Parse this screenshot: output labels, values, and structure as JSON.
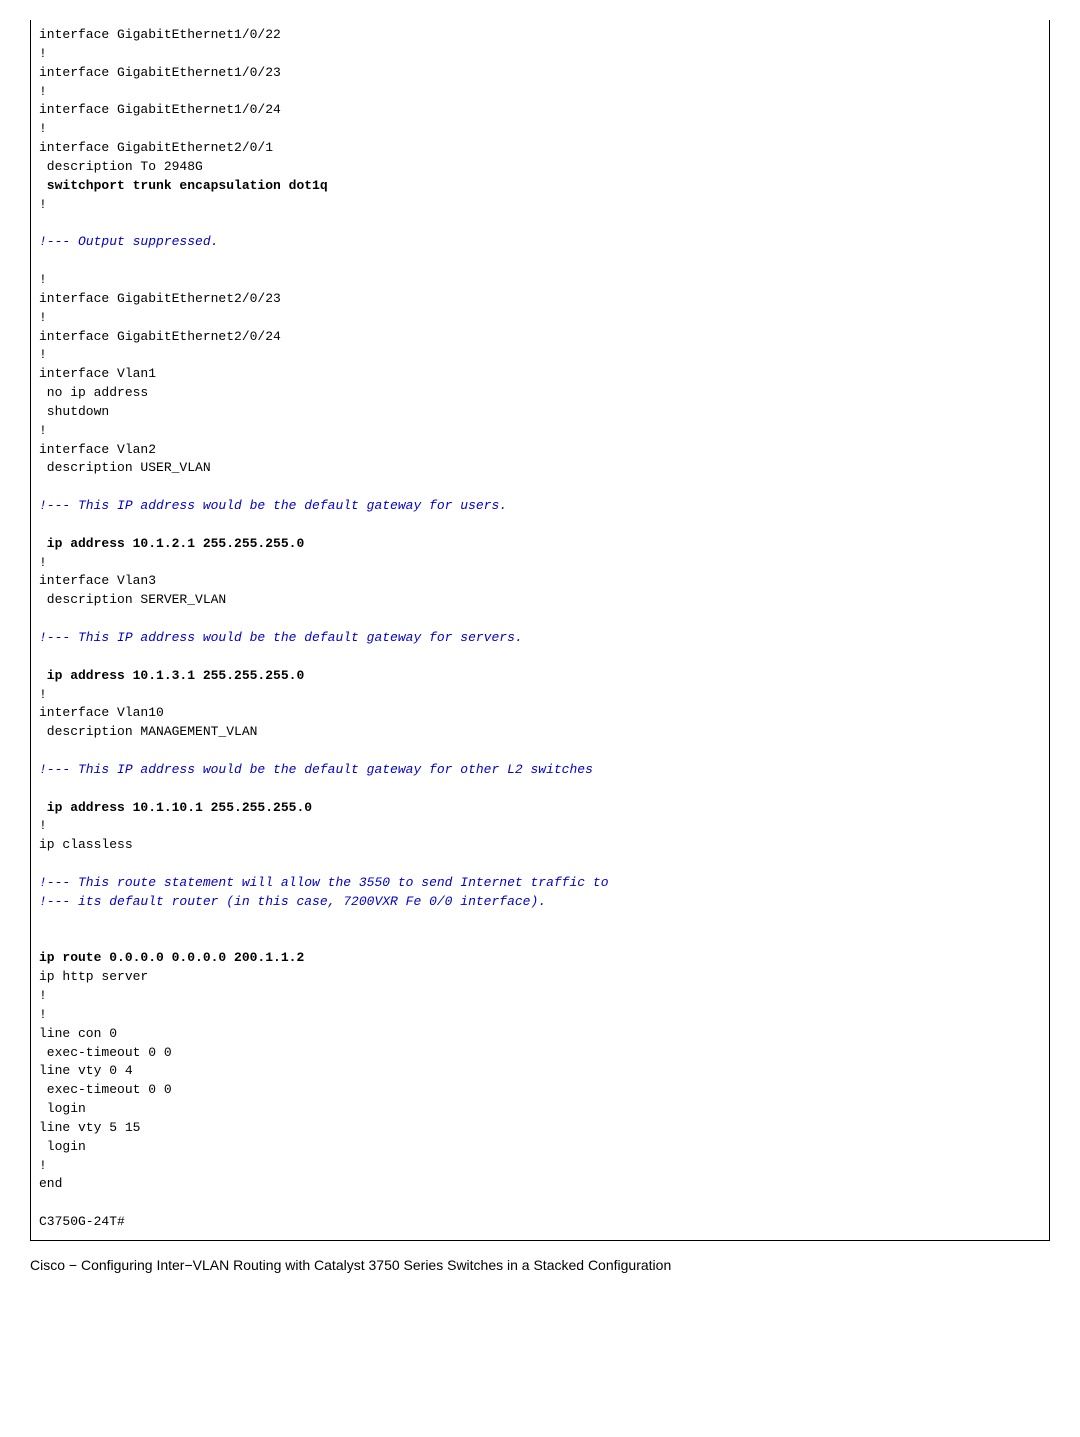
{
  "code": {
    "l01": "interface GigabitEthernet1/0/22",
    "l02": "!",
    "l03": "interface GigabitEthernet1/0/23",
    "l04": "!",
    "l05": "interface GigabitEthernet1/0/24",
    "l06": "!",
    "l07": "interface GigabitEthernet2/0/1",
    "l08": " description To 2948G",
    "l09": " switchport trunk encapsulation dot1q",
    "l10": "!",
    "l11": "!--- Output suppressed.",
    "l12": "!",
    "l13": "interface GigabitEthernet2/0/23",
    "l14": "!",
    "l15": "interface GigabitEthernet2/0/24",
    "l16": "!",
    "l17": "interface Vlan1",
    "l18": " no ip address",
    "l19": " shutdown",
    "l20": "!",
    "l21": "interface Vlan2",
    "l22": " description USER_VLAN",
    "l23": "!--- This IP address would be the default gateway for users.",
    "l24": " ip address 10.1.2.1 255.255.255.0",
    "l25": "!",
    "l26": "interface Vlan3",
    "l27": " description SERVER_VLAN",
    "l28": "!--- This IP address would be the default gateway for servers.",
    "l29": " ip address 10.1.3.1 255.255.255.0",
    "l30": "!",
    "l31": "interface Vlan10",
    "l32": " description MANAGEMENT_VLAN",
    "l33": "!--- This IP address would be the default gateway for other L2 switches",
    "l34": " ip address 10.1.10.1 255.255.255.0",
    "l35": "!",
    "l36": "ip classless",
    "l37": "!--- This route statement will allow the 3550 to send Internet traffic to ",
    "l38": "!--- its default router (in this case, 7200VXR Fe 0/0 interface).",
    "l39": "ip route 0.0.0.0 0.0.0.0 200.1.1.2",
    "l40": "ip http server",
    "l41": "!",
    "l42": "!",
    "l43": "line con 0",
    "l44": " exec-timeout 0 0",
    "l45": "line vty 0 4",
    "l46": " exec-timeout 0 0",
    "l47": " login",
    "l48": "line vty 5 15",
    "l49": " login",
    "l50": "!",
    "l51": "end",
    "l52": "C3750G-24T#"
  },
  "footer": "Cisco − Configuring Inter−VLAN Routing with Catalyst 3750 Series Switches in a Stacked Configuration"
}
